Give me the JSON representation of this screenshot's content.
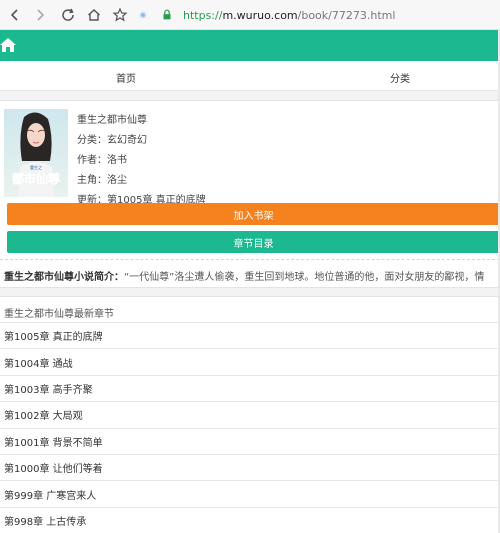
{
  "browser": {
    "url_scheme": "https://",
    "url_host": "m.wuruo.com",
    "url_path": "/book/77273.html"
  },
  "header": {
    "home_icon": "home-icon"
  },
  "nav": {
    "home": "首页",
    "category": "分类"
  },
  "book": {
    "title": "重生之都市仙尊",
    "category": "分类：玄幻奇幻",
    "author": "作者：洛书",
    "protagonist": "主角：洛尘",
    "update": "更新：第1005章 真正的底牌",
    "cover_title": "都市仙尊",
    "cover_small": "重生之"
  },
  "actions": {
    "add_shelf": "加入书架",
    "toc": "章节目录"
  },
  "intro": {
    "label": "重生之都市仙尊小说简介：",
    "text": "“一代仙尊”洛尘遭人偷袭，重生回到地球。地位普通的他，面对女朋友的鄙视，情"
  },
  "latest": {
    "heading": "重生之都市仙尊最新章节",
    "chapters": [
      "第1005章 真正的底牌",
      "第1004章 通战",
      "第1003章 高手齐聚",
      "第1002章 大局观",
      "第1001章 背景不简单",
      "第1000章 让他们等着",
      "第999章 广寒宫来人",
      "第998章 上古传承"
    ]
  },
  "colors": {
    "accent_green": "#1cb88f",
    "accent_orange": "#f6821f"
  }
}
